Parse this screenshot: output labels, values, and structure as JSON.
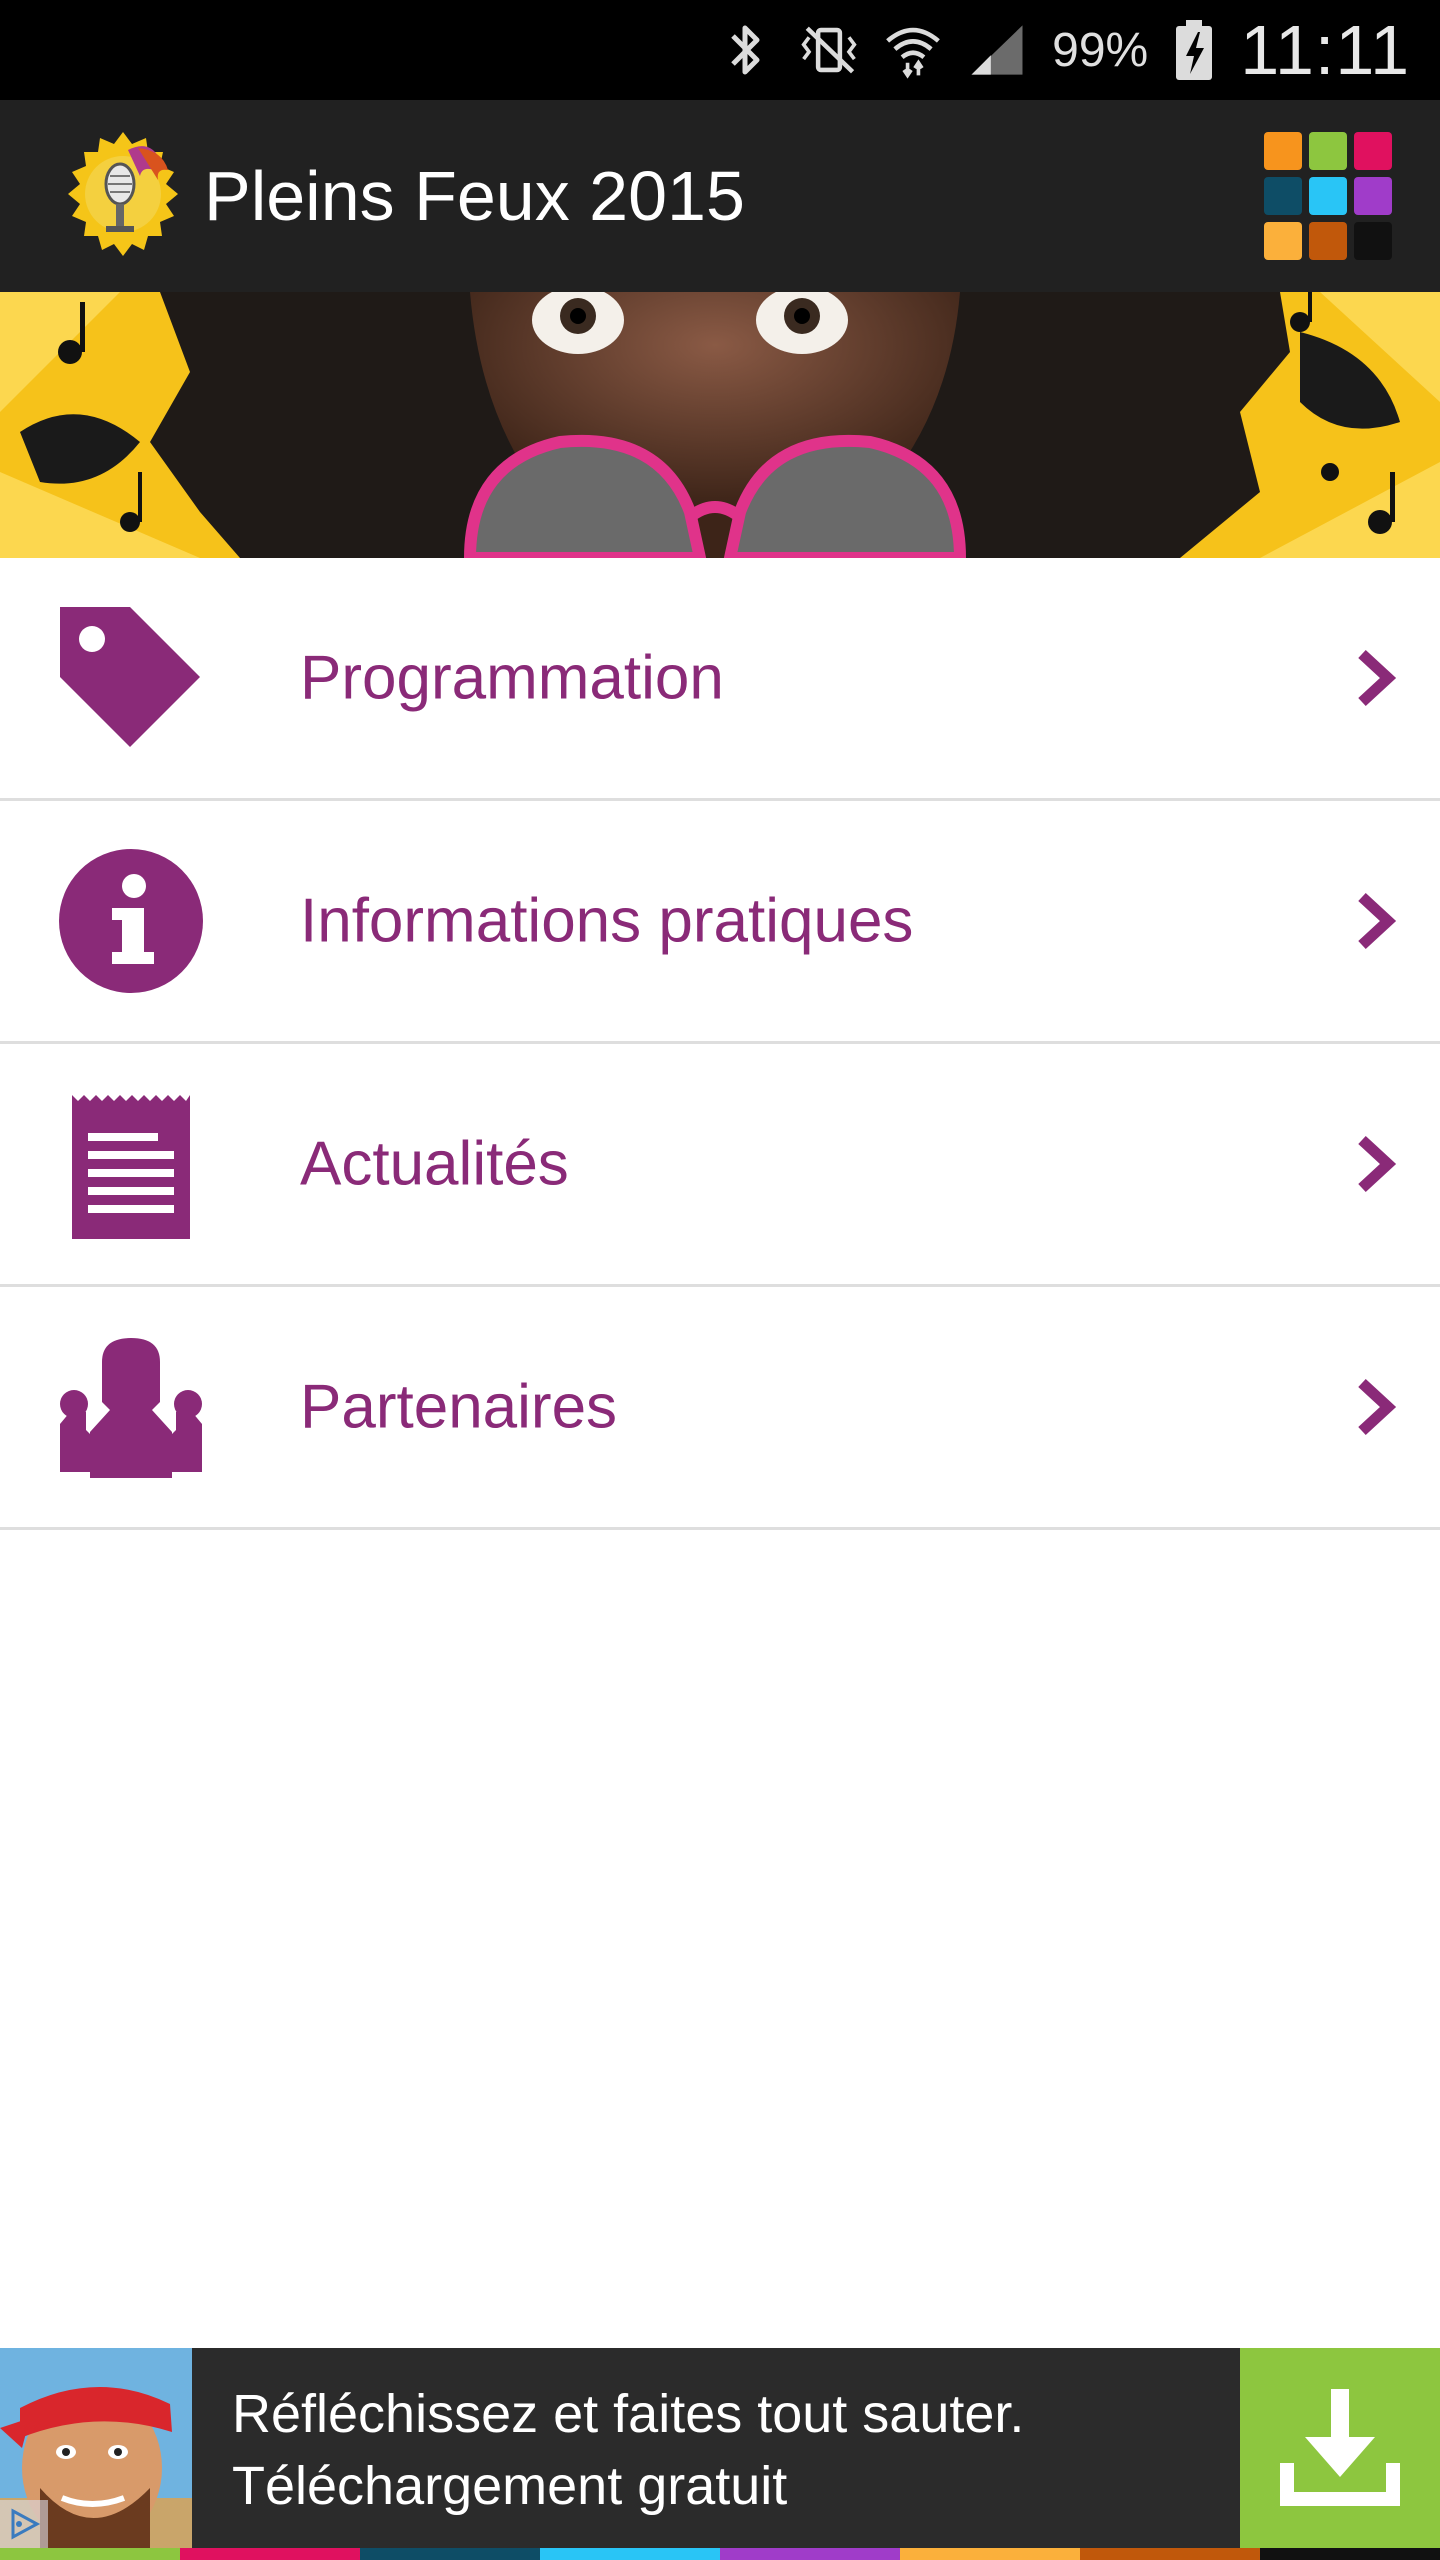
{
  "status_bar": {
    "battery_percent": "99%",
    "time": "11:11",
    "icons": [
      "bluetooth-icon",
      "vibrate-icon",
      "wifi-icon",
      "signal-icon",
      "battery-icon"
    ]
  },
  "app_bar": {
    "title": "Pleins Feux 2015",
    "logo": "microphone-logo",
    "menu_grid_colors": [
      "#f7941d",
      "#8dc63f",
      "#e0115f",
      "#0e4d66",
      "#29c5f6",
      "#a03cc9",
      "#fbb03b",
      "#c1580b",
      "#111111"
    ]
  },
  "menu": {
    "items": [
      {
        "label": "Programmation",
        "icon": "tag-icon"
      },
      {
        "label": "Informations pratiques",
        "icon": "info-icon"
      },
      {
        "label": "Actualités",
        "icon": "newspaper-icon"
      },
      {
        "label": "Partenaires",
        "icon": "people-icon"
      }
    ],
    "accent_color": "#8a2a78"
  },
  "ad": {
    "line1": "Réfléchissez et faites tout sauter.",
    "line2": "Téléchargement gratuit",
    "download_color": "#8dc63f"
  },
  "bottom_strip_colors": [
    "#8dc63f",
    "#e0115f",
    "#0e4d66",
    "#29c5f6",
    "#a03cc9",
    "#fbb03b",
    "#c1580b",
    "#111111"
  ]
}
